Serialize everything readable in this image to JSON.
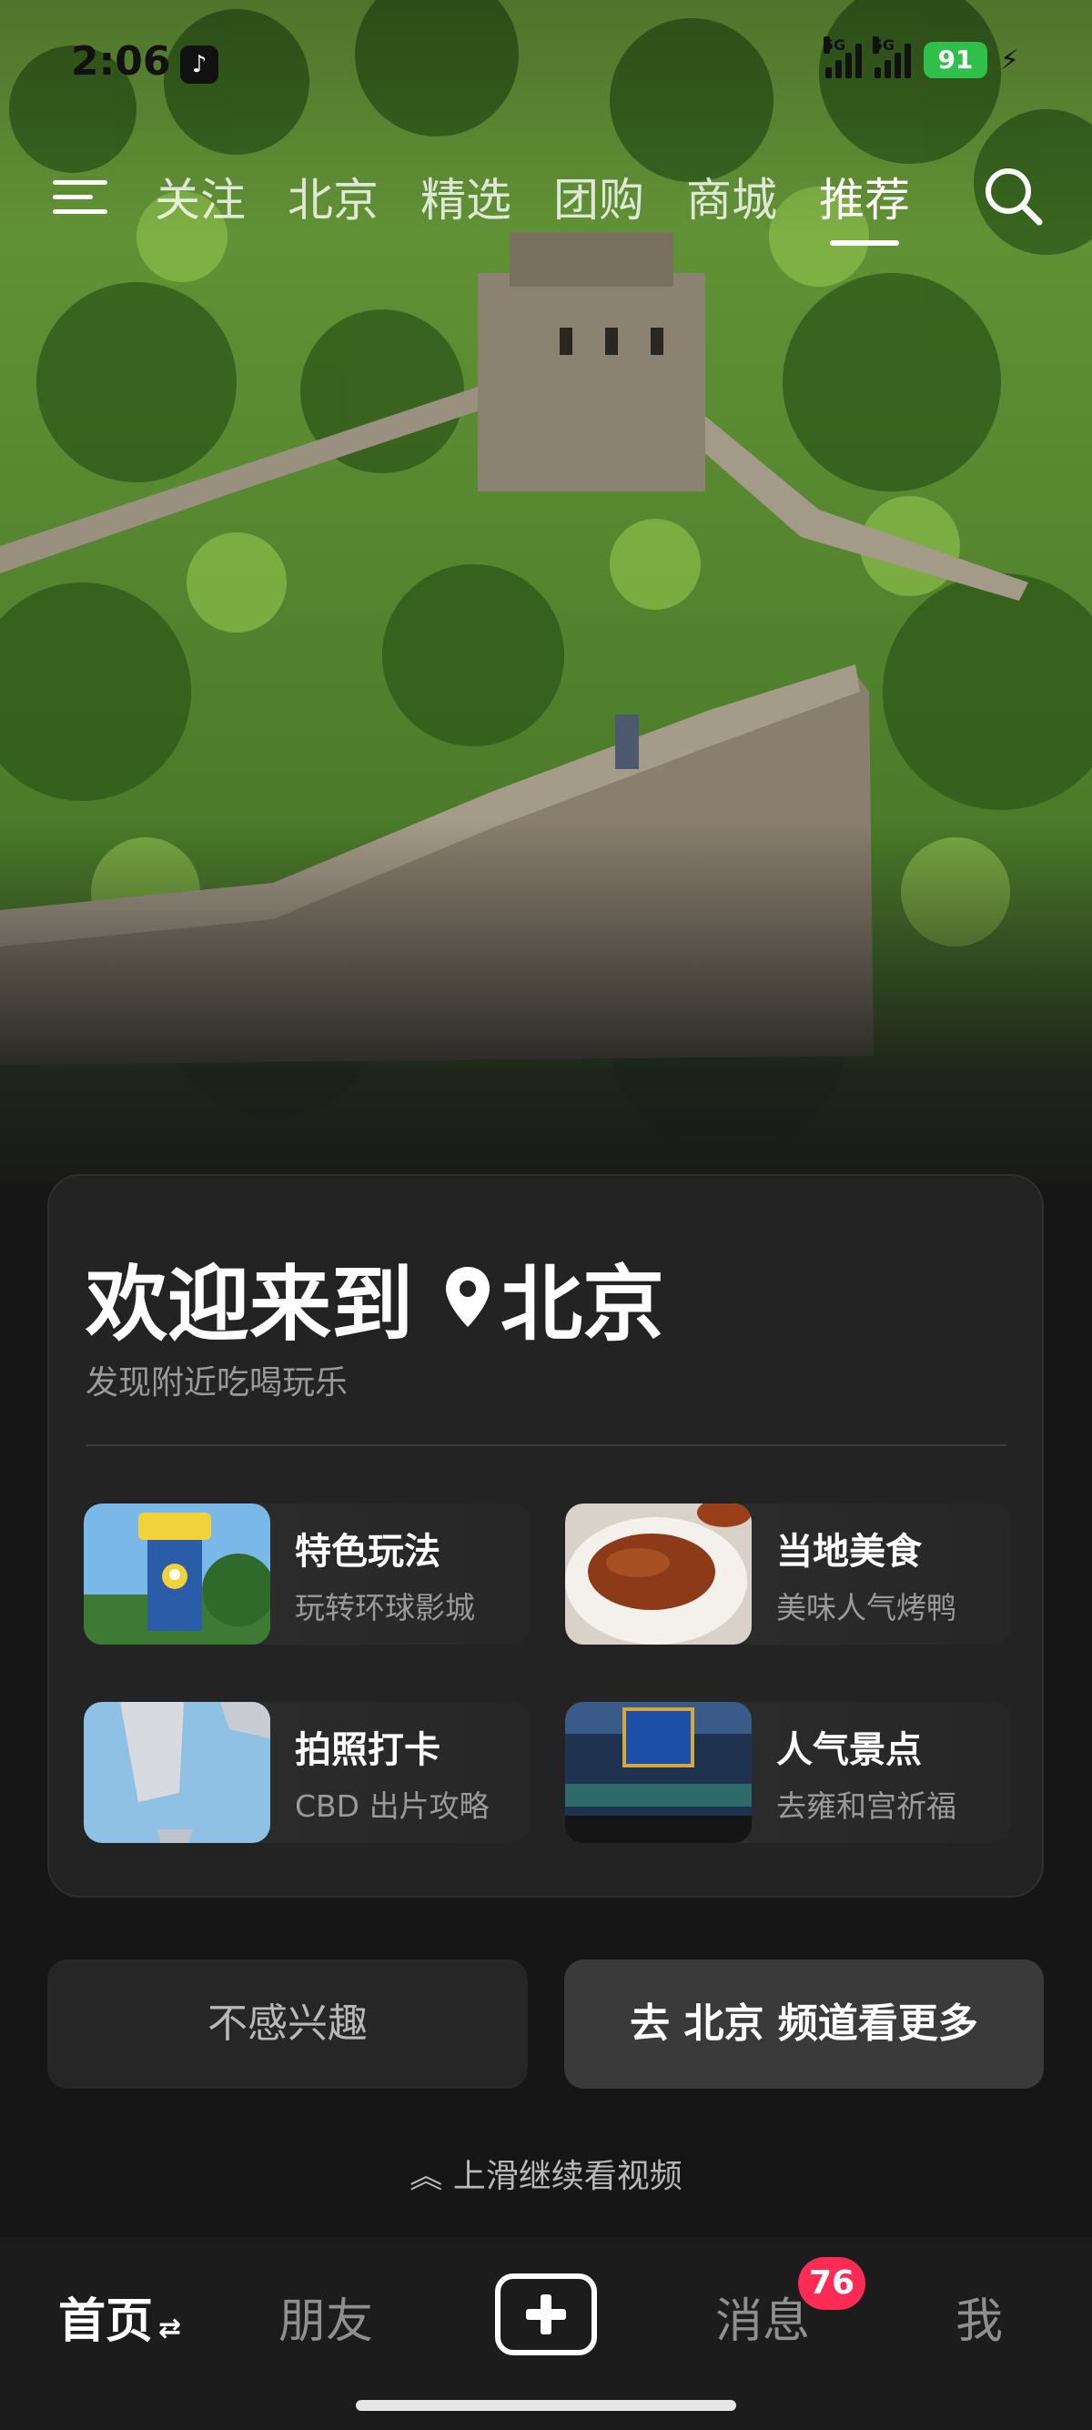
{
  "status_bar": {
    "time": "2:06",
    "app_badge_icon": "tiktok-icon",
    "network_1": "5G",
    "network_2": "5G",
    "battery": "91"
  },
  "top_nav": {
    "tabs": [
      "关注",
      "北京",
      "精选",
      "团购",
      "商城",
      "推荐"
    ],
    "active_tab": "推荐",
    "menu_icon": "menu-icon",
    "search_icon": "search-icon"
  },
  "welcome_card": {
    "title_prefix": "欢迎来到",
    "city": "北京",
    "subtitle": "发现附近吃喝玩乐",
    "tiles": [
      {
        "title": "特色玩法",
        "subtitle": "玩转环球影城"
      },
      {
        "title": "当地美食",
        "subtitle": "美味人气烤鸭"
      },
      {
        "title": "拍照打卡",
        "subtitle": "CBD 出片攻略"
      },
      {
        "title": "人气景点",
        "subtitle": "去雍和宫祈福"
      }
    ]
  },
  "actions": {
    "not_interested": "不感兴趣",
    "go_channel": "去 北京 频道看更多"
  },
  "swipe_hint": "上滑继续看视频",
  "bottom_nav": {
    "home": "首页",
    "friends": "朋友",
    "messages": "消息",
    "messages_badge": "76",
    "me": "我"
  },
  "colors": {
    "accent_badge": "#fe2c55",
    "battery": "#2fbf4a",
    "card_bg": "#232323"
  }
}
